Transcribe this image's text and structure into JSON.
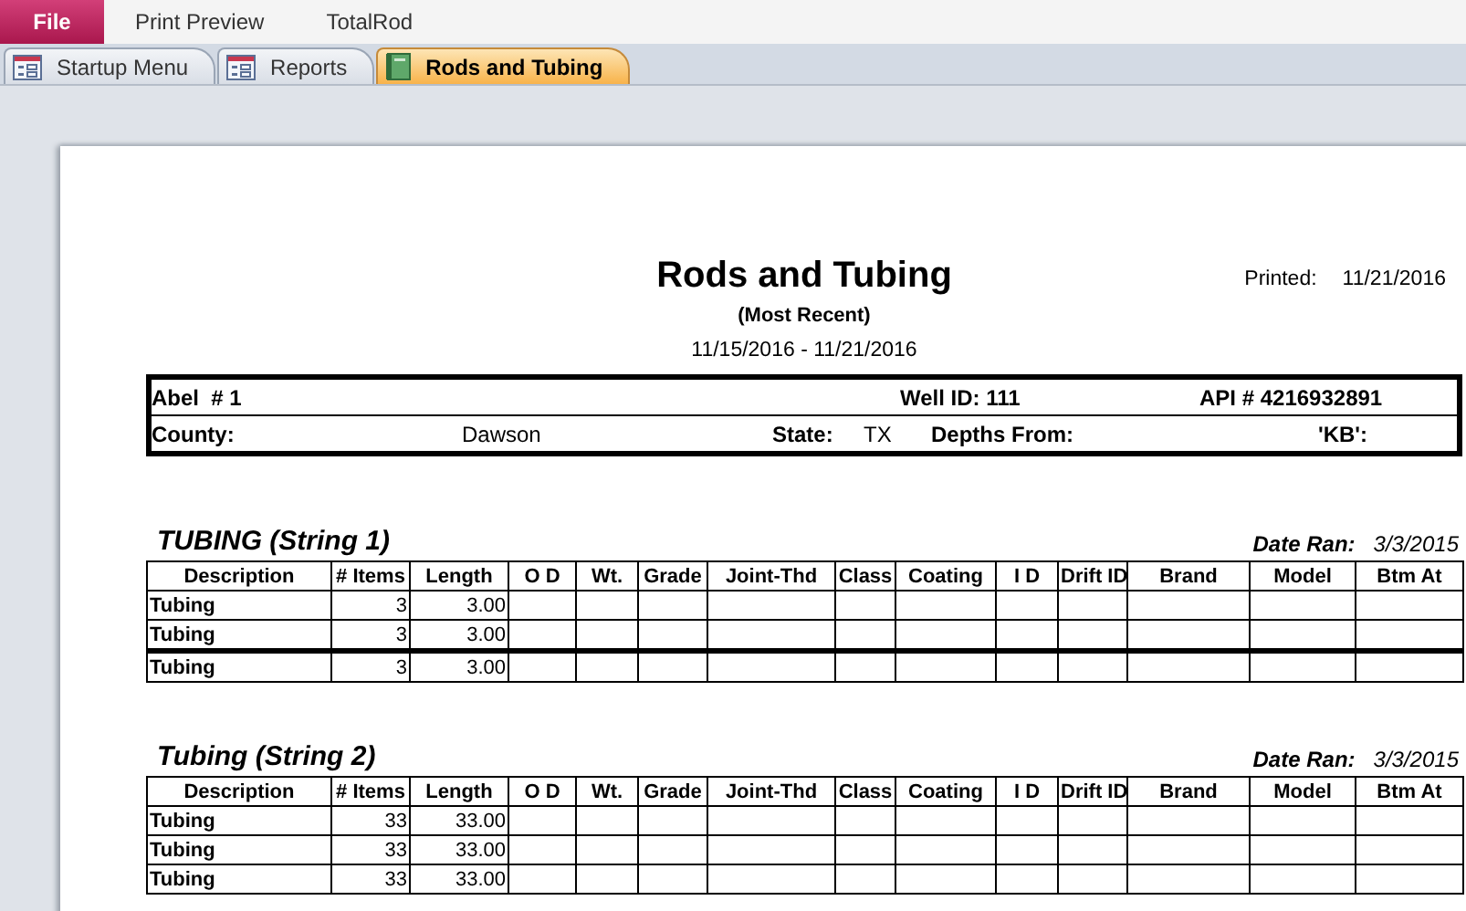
{
  "ribbon": {
    "file_tab": "File",
    "tabs": [
      {
        "label": "Print Preview"
      },
      {
        "label": "TotalRod"
      }
    ]
  },
  "document_tabs": [
    {
      "label": "Startup Menu",
      "selected": false,
      "kind": "form"
    },
    {
      "label": "Reports",
      "selected": false,
      "kind": "form"
    },
    {
      "label": "Rods and Tubing",
      "selected": true,
      "kind": "report"
    }
  ],
  "report": {
    "title": "Rods and Tubing",
    "subtitle": "(Most Recent)",
    "date_range": "11/15/2016 - 11/21/2016",
    "printed_label": "Printed:",
    "printed_date": "11/21/2016",
    "well": {
      "name": "Abel  # 1",
      "well_id_label": "Well ID:",
      "well_id": "111",
      "api_label": "API #",
      "api": "4216932891",
      "county_label": "County:",
      "county": "Dawson",
      "state_label": "State:",
      "state": "TX",
      "depths_label": "Depths From:",
      "kb_label": "'KB':"
    },
    "sections": [
      {
        "title": "TUBING (String 1)",
        "date_label": "Date Ran:",
        "date": "3/3/2015",
        "columns": [
          "Description",
          "# Items",
          "Length",
          "O D",
          "Wt.",
          "Grade",
          "Joint-Thd",
          "Class",
          "Coating",
          "I D",
          "Drift ID",
          "Brand",
          "Model",
          "Btm At"
        ],
        "rows": [
          {
            "cells": [
              "Tubing",
              "3",
              "3.00"
            ],
            "break_before": false
          },
          {
            "cells": [
              "Tubing",
              "3",
              "3.00"
            ],
            "break_before": false
          },
          {
            "cells": [
              "Tubing",
              "3",
              "3.00"
            ],
            "break_before": true
          }
        ]
      },
      {
        "title": "Tubing (String 2)",
        "date_label": "Date Ran:",
        "date": "3/3/2015",
        "columns": [
          "Description",
          "# Items",
          "Length",
          "O D",
          "Wt.",
          "Grade",
          "Joint-Thd",
          "Class",
          "Coating",
          "I D",
          "Drift ID",
          "Brand",
          "Model",
          "Btm At"
        ],
        "rows": [
          {
            "cells": [
              "Tubing",
              "33",
              "33.00"
            ],
            "break_before": false
          },
          {
            "cells": [
              "Tubing",
              "33",
              "33.00"
            ],
            "break_before": false
          },
          {
            "cells": [
              "Tubing",
              "33",
              "33.00"
            ],
            "break_before": false
          }
        ]
      }
    ]
  }
}
